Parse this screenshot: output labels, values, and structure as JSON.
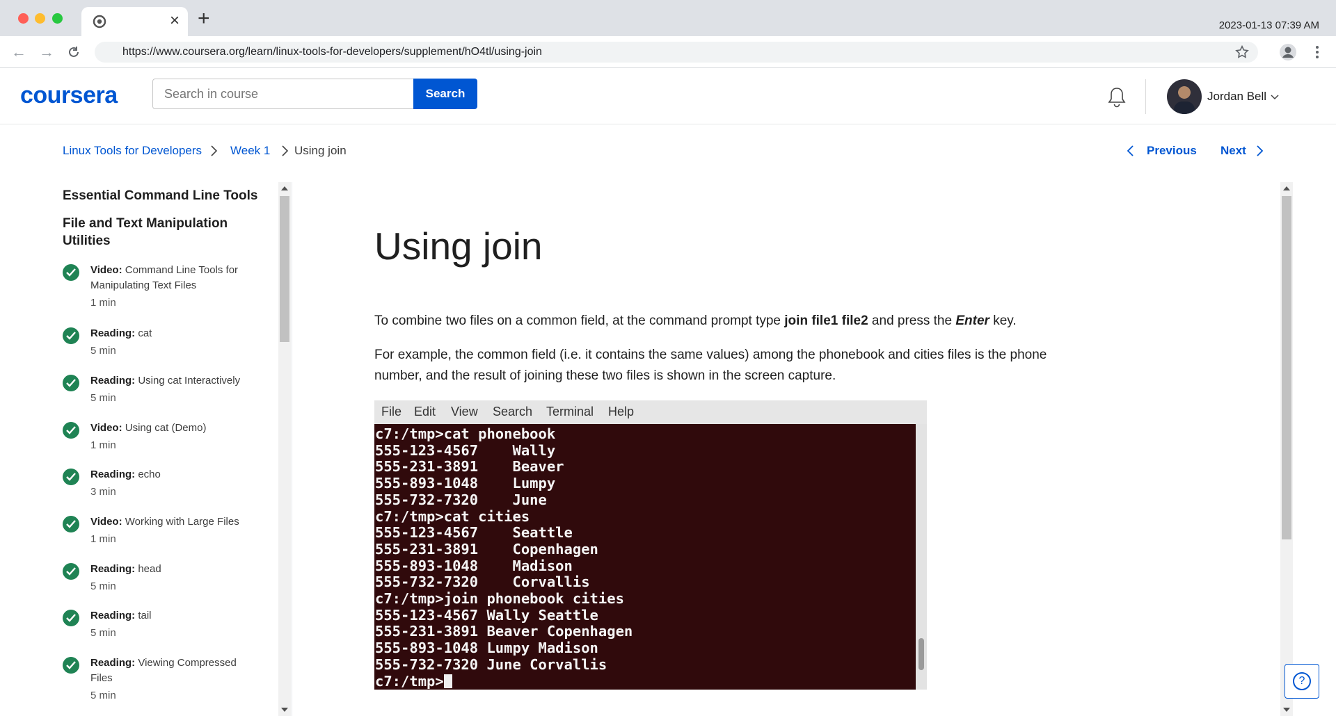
{
  "browser": {
    "clock": "2023-01-13 07:39 AM",
    "url": "https://www.coursera.org/learn/linux-tools-for-developers/supplement/hO4tl/using-join",
    "close_tab_glyph": "×",
    "new_tab_glyph": "+"
  },
  "header": {
    "logo": "coursera",
    "search_placeholder": "Search in course",
    "search_button": "Search",
    "user_name": "Jordan Bell"
  },
  "breadcrumb": {
    "course": "Linux Tools for Developers",
    "week": "Week 1",
    "current": "Using join"
  },
  "nav": {
    "previous": "Previous",
    "next": "Next"
  },
  "sidebar": {
    "module_title": "Essential Command Line Tools",
    "section_title": "File and Text Manipulation Utilities",
    "items": [
      {
        "type": "Video:",
        "title": "Command Line Tools for Manipulating Text Files",
        "duration": "1 min"
      },
      {
        "type": "Reading:",
        "title": "cat",
        "duration": "5 min"
      },
      {
        "type": "Reading:",
        "title": "Using cat Interactively",
        "duration": "5 min"
      },
      {
        "type": "Video:",
        "title": "Using cat (Demo)",
        "duration": "1 min"
      },
      {
        "type": "Reading:",
        "title": "echo",
        "duration": "3 min"
      },
      {
        "type": "Video:",
        "title": "Working with Large Files",
        "duration": "1 min"
      },
      {
        "type": "Reading:",
        "title": "head",
        "duration": "5 min"
      },
      {
        "type": "Reading:",
        "title": "tail",
        "duration": "5 min"
      },
      {
        "type": "Reading:",
        "title": "Viewing Compressed Files",
        "duration": "5 min"
      }
    ]
  },
  "content": {
    "title": "Using join",
    "p1_before": "To combine two files on a common field, at the command prompt type ",
    "p1_cmd": "join file1 file2",
    "p1_middle": " and press the ",
    "p1_key": "Enter",
    "p1_after": " key.",
    "p2": "For example, the common field (i.e. it contains the same values) among the phonebook and cities files is the phone number, and the result of joining these two files is shown in the screen capture."
  },
  "terminal": {
    "menu": [
      "File",
      "Edit",
      "View",
      "Search",
      "Terminal",
      "Help"
    ],
    "lines": [
      "c7:/tmp>cat phonebook",
      "555-123-4567    Wally",
      "555-231-3891    Beaver",
      "555-893-1048    Lumpy",
      "555-732-7320    June",
      "c7:/tmp>cat cities",
      "555-123-4567    Seattle",
      "555-231-3891    Copenhagen",
      "555-893-1048    Madison",
      "555-732-7320    Corvallis",
      "c7:/tmp>join phonebook cities",
      "555-123-4567 Wally Seattle",
      "555-231-3891 Beaver Copenhagen",
      "555-893-1048 Lumpy Madison",
      "555-732-7320 June Corvallis"
    ],
    "prompt": "c7:/tmp>"
  },
  "help": {
    "glyph": "?"
  },
  "colors": {
    "brand": "#0056d2",
    "complete": "#1f8354",
    "terminal_bg": "#300a0c"
  }
}
